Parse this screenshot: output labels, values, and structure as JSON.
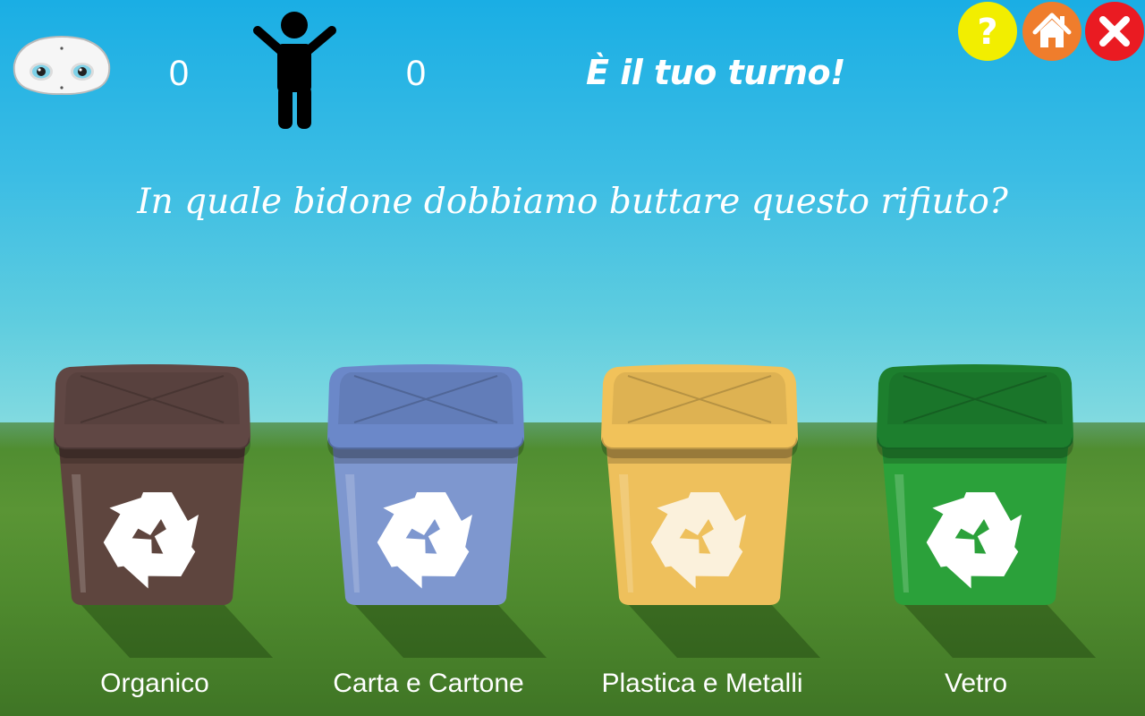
{
  "header": {
    "robot_score": "0",
    "player_score": "0",
    "turn_text": "È il tuo turno!"
  },
  "question": "In quale bidone dobbiamo buttare questo rifiuto?",
  "buttons": {
    "help_glyph": "?"
  },
  "icons": {
    "robot": "robot-face-icon",
    "player": "child-figure-icon",
    "help": "question-mark-icon",
    "home": "home-icon",
    "close": "close-icon",
    "recycle": "recycle-icon"
  },
  "colors": {
    "help_button": "#f2ee00",
    "home_button": "#ef7d2c",
    "close_button": "#ea1b22",
    "organico": "#5e453e",
    "carta": "#7e97cf",
    "plastica": "#eec05c",
    "vetro": "#2ba13a"
  },
  "bins": [
    {
      "label": "Organico",
      "color": "#5e453e",
      "lid": "#604744"
    },
    {
      "label": "Carta e Cartone",
      "color": "#7e97cf",
      "lid": "#6b88c9"
    },
    {
      "label": "Plastica e Metalli",
      "color": "#eec05c",
      "lid": "#f1c25a"
    },
    {
      "label": "Vetro",
      "color": "#2ba13a",
      "lid": "#1d7f2e"
    }
  ]
}
